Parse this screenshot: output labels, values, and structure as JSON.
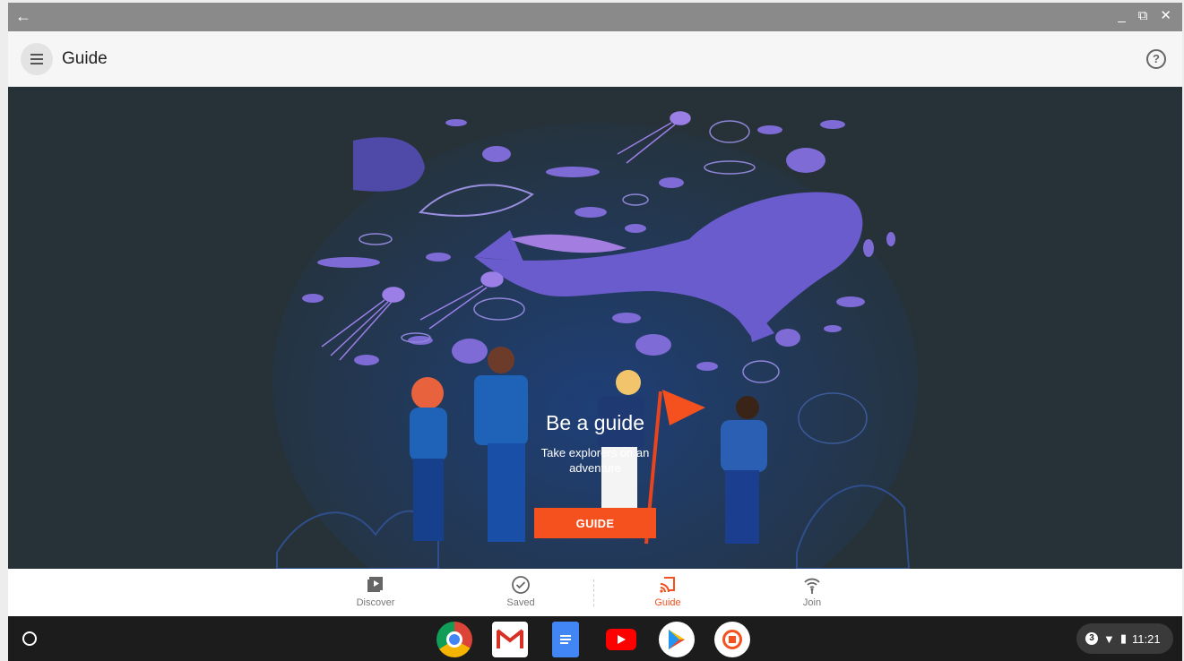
{
  "window": {
    "back_icon": "arrow-left-icon",
    "minimize": "_",
    "restore": "⧉",
    "close": "✕"
  },
  "appbar": {
    "title": "Guide",
    "menu_icon": "hamburger-menu-icon",
    "help": "?"
  },
  "hero": {
    "title": "Be a guide",
    "subtitle_line1": "Take explorers on an",
    "subtitle_line2": "adventure",
    "button_label": "GUIDE"
  },
  "bottom_nav": {
    "items": [
      {
        "label": "Discover",
        "icon": "play-library-icon"
      },
      {
        "label": "Saved",
        "icon": "check-circle-icon"
      },
      {
        "label": "Guide",
        "icon": "guide-cast-icon"
      },
      {
        "label": "Join",
        "icon": "signal-icon"
      }
    ],
    "active": "Guide"
  },
  "shelf": {
    "apps": [
      "chrome-icon",
      "gmail-icon",
      "docs-icon",
      "youtube-icon",
      "play-store-icon",
      "expeditions-icon"
    ],
    "notification_count": "3",
    "time": "11:21"
  },
  "colors": {
    "accent": "#f4511e",
    "hero_bg": "#263238",
    "fish": "#7e6bd6",
    "whale": "#6a5ccc"
  }
}
